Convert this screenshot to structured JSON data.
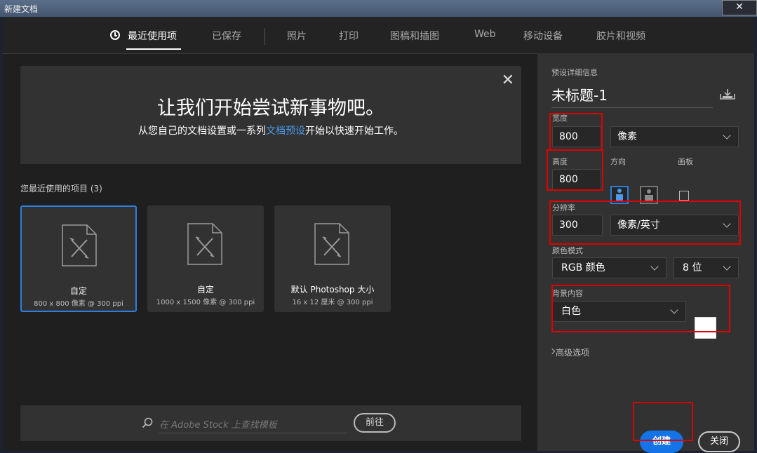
{
  "window": {
    "title": "新建文档",
    "close_glyph": "✕"
  },
  "tabs": [
    {
      "label": "最近使用项",
      "active": true
    },
    {
      "label": "已保存"
    },
    {
      "label": "照片"
    },
    {
      "label": "打印"
    },
    {
      "label": "图稿和插图"
    },
    {
      "label": "Web"
    },
    {
      "label": "移动设备"
    },
    {
      "label": "胶片和视频"
    }
  ],
  "banner": {
    "heading": "让我们开始尝试新事物吧。",
    "sub_before": "从您自己的文档设置或一系列",
    "sub_link": "文档预设",
    "sub_after": "开始以快速开始工作。",
    "close_glyph": "✕"
  },
  "recent": {
    "title": "您最近使用的项目",
    "count": "(3)",
    "items": [
      {
        "name": "自定",
        "info": "800 x 800 像素 @ 300 ppi",
        "selected": true
      },
      {
        "name": "自定",
        "info": "1000 x 1500 像素 @ 300 ppi"
      },
      {
        "name": "默认 Photoshop 大小",
        "info": "16 x 12 厘米 @ 300 ppi"
      }
    ]
  },
  "stock": {
    "placeholder": "在 Adobe Stock 上查找模板",
    "go_label": "前往"
  },
  "preset": {
    "section_label": "预设详细信息",
    "doc_name": "未标题-1",
    "width_label": "宽度",
    "width_value": "800",
    "width_unit": "像素",
    "height_label": "高度",
    "height_value": "800",
    "orientation_label": "方向",
    "artboard_label": "画板",
    "resolution_label": "分辨率",
    "resolution_value": "300",
    "resolution_unit": "像素/英寸",
    "color_mode_label": "颜色模式",
    "color_mode": "RGB 颜色",
    "bit_depth": "8 位",
    "bg_label": "背景内容",
    "bg_value": "白色",
    "bg_color": "#ffffff",
    "advanced_label": "高级选项",
    "create_label": "创建",
    "close_label": "关闭"
  },
  "colors": {
    "accent": "#1473e6",
    "highlight": "#e00000",
    "link": "#4c9bea"
  }
}
